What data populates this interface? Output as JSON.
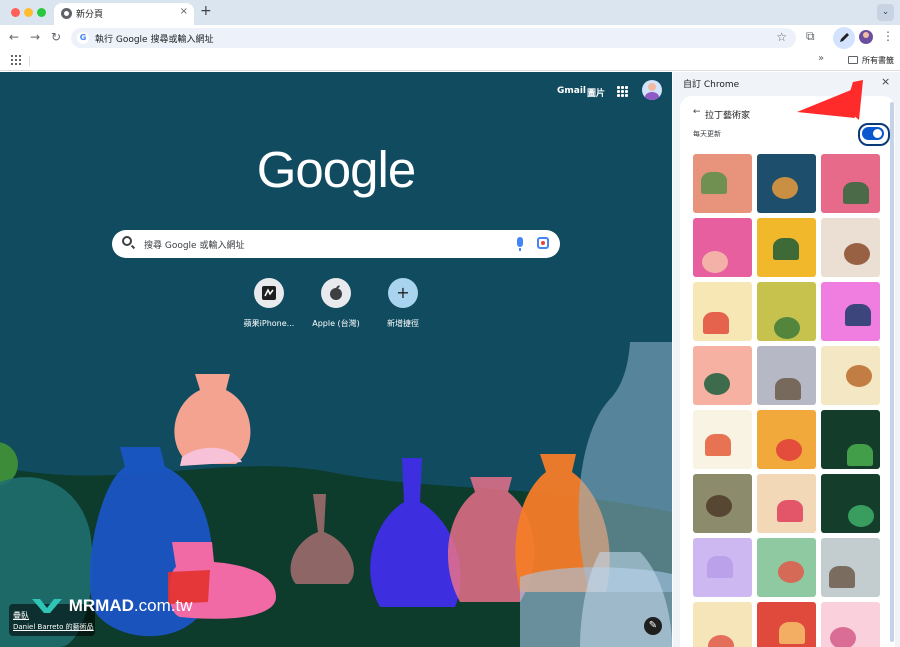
{
  "tab": {
    "title": "新分頁",
    "close_glyph": "×",
    "new_tab_glyph": "+",
    "menu_glyph": "⌄"
  },
  "toolbar": {
    "back_glyph": "←",
    "forward_glyph": "→",
    "reload_glyph": "↻",
    "omnibox_text": "執行 Google 搜尋或輸入網址",
    "star_glyph": "☆",
    "menu_glyph": "⋮",
    "extension_glyph": "⧉"
  },
  "bookmarks": {
    "more_glyph": "»",
    "all_bookmarks_label": "所有書籤"
  },
  "ntp": {
    "gmail_label": "Gmail",
    "images_label": "圖片",
    "logo_text": "Google",
    "search_placeholder": "搜尋 Google 或輸入網址",
    "shortcuts": [
      {
        "label": "蘋果iPhone...",
        "icon": "mrmad-icon",
        "glyph": "▚"
      },
      {
        "label": "Apple (台灣)",
        "icon": "apple-icon",
        "glyph": ""
      },
      {
        "label": "新增捷徑",
        "icon": "plus-icon",
        "glyph": "+"
      }
    ],
    "credit_title": "疊臥",
    "credit_author": "Daniel Barreto 的藝術品",
    "watermark_brand": "MRMAD",
    "watermark_domain": ".com.tw",
    "edit_glyph": "✎",
    "background_color": "#104b60"
  },
  "side_panel": {
    "title": "自訂 Chrome",
    "close_glyph": "×",
    "back_glyph": "←",
    "heading": "拉丁藝術家",
    "daily_refresh_label": "每天更新",
    "daily_refresh_on": true,
    "tiles": [
      {
        "name": "tile-landscape-pink",
        "bg": "#e8937c",
        "accent": "#5a8f4a"
      },
      {
        "name": "tile-teal-figures",
        "bg": "#1d4e6b",
        "accent": "#e89b3c"
      },
      {
        "name": "tile-pink-mountain",
        "bg": "#e86a8a",
        "accent": "#2f6b3c"
      },
      {
        "name": "tile-pink-hands",
        "bg": "#e85fa0",
        "accent": "#f4c0a8"
      },
      {
        "name": "tile-yellow-abstract",
        "bg": "#f2b82c",
        "accent": "#1f5c3a"
      },
      {
        "name": "tile-woman-hat",
        "bg": "#eadfd2",
        "accent": "#8a4b2c"
      },
      {
        "name": "tile-food-pattern",
        "bg": "#f6e7b5",
        "accent": "#e24b3a"
      },
      {
        "name": "tile-green-yellow",
        "bg": "#c7c24e",
        "accent": "#3e7a3a"
      },
      {
        "name": "tile-pink-portrait",
        "bg": "#f07ee0",
        "accent": "#1d3b6b"
      },
      {
        "name": "tile-salmon-figure",
        "bg": "#f6b1a3",
        "accent": "#1f5f3e"
      },
      {
        "name": "tile-grey-elephant",
        "bg": "#b7b8c6",
        "accent": "#6d5a4a"
      },
      {
        "name": "tile-cookies",
        "bg": "#f4e7c3",
        "accent": "#b86a2c"
      },
      {
        "name": "tile-fruits",
        "bg": "#f8f3e3",
        "accent": "#e45c3a"
      },
      {
        "name": "tile-orange-jar",
        "bg": "#f2a93b",
        "accent": "#e23d3d"
      },
      {
        "name": "tile-dark-green",
        "bg": "#133d2a",
        "accent": "#4caf50"
      },
      {
        "name": "tile-canyon",
        "bg": "#8c8c6c",
        "accent": "#4e3a28"
      },
      {
        "name": "tile-cream-flowers",
        "bg": "#f2d8b6",
        "accent": "#e0405c"
      },
      {
        "name": "tile-tropical",
        "bg": "#143d2c",
        "accent": "#3fae6a"
      },
      {
        "name": "tile-lavender",
        "bg": "#cdb8f2",
        "accent": "#b79ce8"
      },
      {
        "name": "tile-mint-dancer",
        "bg": "#8fc9a1",
        "accent": "#e2594a"
      },
      {
        "name": "tile-grey-figure",
        "bg": "#c3cdd0",
        "accent": "#6d5a4a"
      },
      {
        "name": "tile-cream-bottom",
        "bg": "#f6e5b8",
        "accent": "#e2594a"
      },
      {
        "name": "tile-red-bottom",
        "bg": "#e04a3c",
        "accent": "#f6c06a"
      },
      {
        "name": "tile-pink-bottom",
        "bg": "#f9d0dc",
        "accent": "#d45c8a"
      }
    ]
  }
}
